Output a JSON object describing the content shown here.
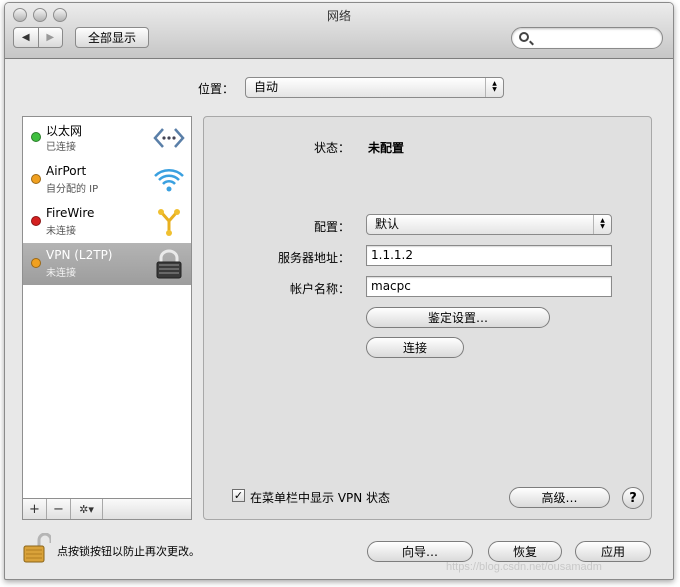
{
  "window": {
    "title": "网络"
  },
  "toolbar": {
    "back_icon": "back-arrow-icon",
    "forward_icon": "forward-arrow-icon",
    "show_all_label": "全部显示",
    "search": {
      "value": "",
      "placeholder": "",
      "icon": "search-icon"
    }
  },
  "location": {
    "label": "位置：",
    "value": "自动"
  },
  "services": [
    {
      "name": "以太网",
      "status": "已连接",
      "dot_color": "#3fbf3f",
      "icon": "ethernet-icon",
      "selected": false
    },
    {
      "name": "AirPort",
      "status": "自分配的 IP",
      "dot_color": "#f0a020",
      "icon": "wifi-icon",
      "selected": false
    },
    {
      "name": "FireWire",
      "status": "未连接",
      "dot_color": "#d42020",
      "icon": "firewire-icon",
      "selected": false
    },
    {
      "name": "VPN (L2TP)",
      "status": "未连接",
      "dot_color": "#f0a020",
      "icon": "vpn-lock-icon",
      "selected": true
    }
  ],
  "sidebar_tools": {
    "add": "+",
    "remove": "−",
    "gear": "✲▾"
  },
  "detail": {
    "status_label": "状态：",
    "status_value": "未配置",
    "config_label": "配置：",
    "config_value": "默认",
    "server_label": "服务器地址：",
    "server_value": "1.1.1.2",
    "account_label": "帐户名称：",
    "account_value": "macpc",
    "auth_button": "鉴定设置…",
    "connect_button": "连接",
    "show_in_menubar_label": "在菜单栏中显示 VPN 状态",
    "show_in_menubar_checked": "✓",
    "advanced_button": "高级…",
    "help_button": "?"
  },
  "footer": {
    "lock_text": "点按锁按钮以防止再次更改。",
    "assist_button": "向导…",
    "revert_button": "恢复",
    "apply_button": "应用"
  },
  "watermark": "https://blog.csdn.net/ousamadm"
}
